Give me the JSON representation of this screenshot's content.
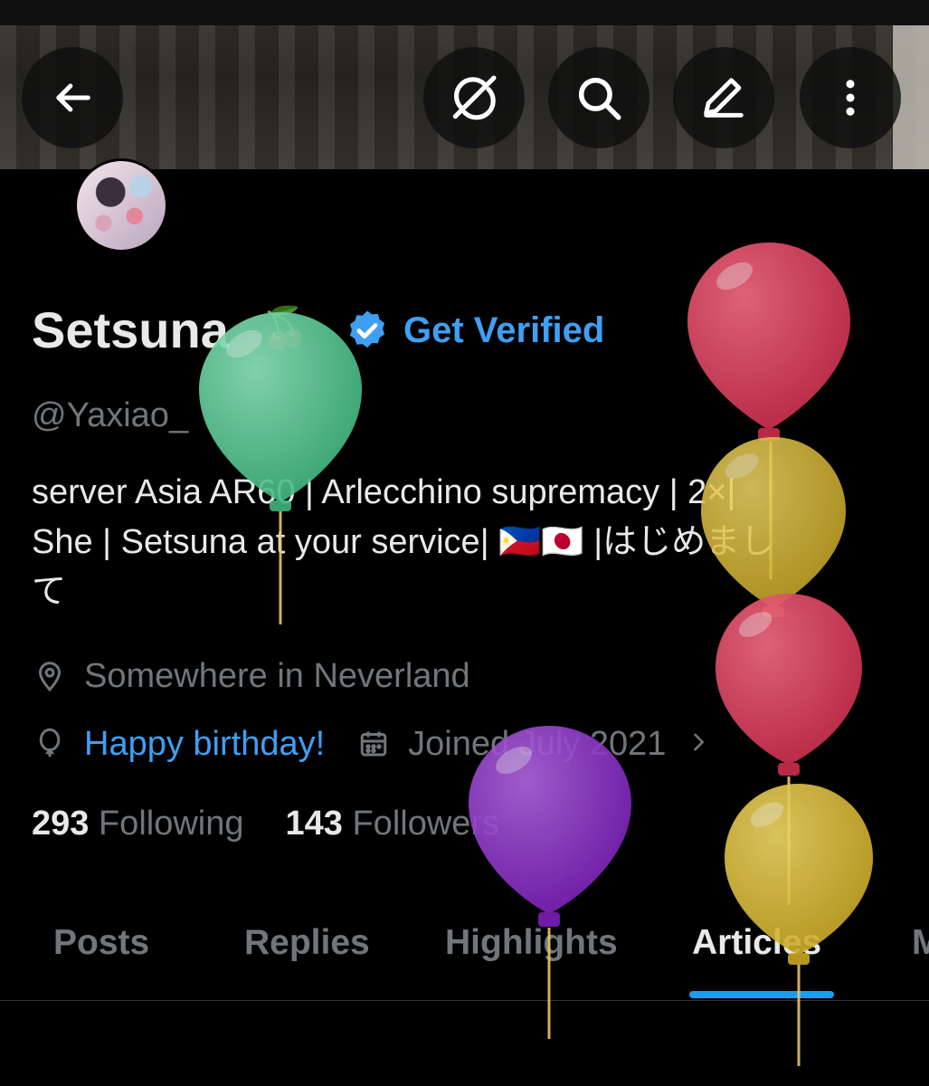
{
  "header": {
    "back_icon": "back-arrow-icon",
    "actions": [
      "grok-icon",
      "search-icon",
      "edit-icon",
      "more-vertical-icon"
    ]
  },
  "profile": {
    "name": "Setsuna",
    "name_emoji": "🍒",
    "get_verified": "Get Verified",
    "handle": "@Yaxiao_",
    "bio_lines": [
      "server Asia AR60 | Arlecchino supremacy | 2×|",
      "She | Setsuna at your service| 🇵🇭🇯🇵 |はじめまし",
      "て"
    ],
    "location": "Somewhere in Neverland",
    "birthday": "Happy birthday!",
    "joined": "Joined July 2021",
    "following_count": "293",
    "following_label": "Following",
    "followers_count": "143",
    "followers_label": "Followers"
  },
  "tabs": [
    "Posts",
    "Replies",
    "Highlights",
    "Articles",
    "M"
  ],
  "active_tab": "Articles",
  "colors": {
    "accent": "#1d9bf0",
    "link": "#3f9ff2",
    "muted": "#71767b",
    "balloon_green": "#5fd19a",
    "balloon_red": "#d93c5a",
    "balloon_yellow": "#dcbc3a",
    "balloon_purple": "#8b2fc4"
  }
}
